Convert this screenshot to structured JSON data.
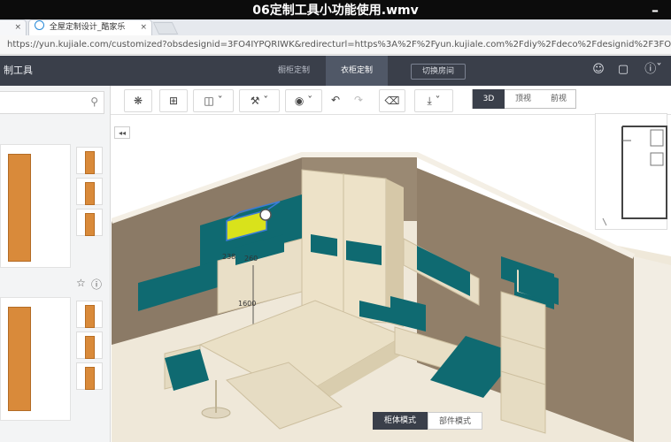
{
  "video": {
    "title": "06定制工具小功能使用.wmv",
    "minimize": "–"
  },
  "browser": {
    "tabs": [
      {
        "label": "全屋定制设计_酷家乐"
      }
    ],
    "close_glyph": "×",
    "url": "https://yun.kujiale.com/customized?obsdesignid=3FO4IYPQRIWK&redirecturl=https%3A%2F%2Fyun.kujiale.com%2Fdiy%2Fdeco%2Fdesignid%2F3FO4IYPQRIWK"
  },
  "header": {
    "title": "制工具",
    "tabs": [
      {
        "label": "橱柜定制"
      },
      {
        "label": "衣柜定制"
      }
    ],
    "switch_room": "切换房间"
  },
  "toolbar": {
    "view_modes": [
      "3D",
      "顶视",
      "前视"
    ]
  },
  "left_panel": {
    "search_placeholder": ""
  },
  "viewport": {
    "dimension_labels": [
      "238",
      "260",
      "1600"
    ],
    "mode_buttons": [
      "柜体模式",
      "部件模式"
    ],
    "collapse": "◂◂"
  },
  "colors": {
    "header_bg": "#3a3f4a",
    "cabinet_teal": "#0f6b72",
    "wood": "#ece3cf",
    "wall": "#8c7c68",
    "highlight": "#dbe41e"
  }
}
